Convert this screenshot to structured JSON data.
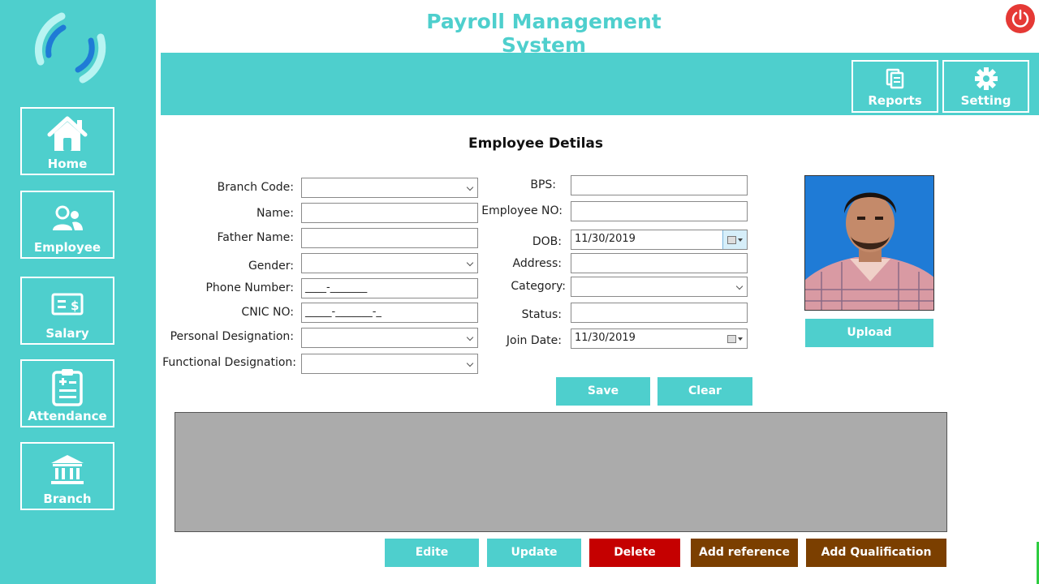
{
  "app": {
    "title": "Payroll Management System"
  },
  "sidebar": {
    "items": [
      {
        "label": "Home",
        "icon": "home-icon"
      },
      {
        "label": "Employee",
        "icon": "users-icon"
      },
      {
        "label": "Salary",
        "icon": "money-icon"
      },
      {
        "label": "Attendance",
        "icon": "clipboard-icon"
      },
      {
        "label": "Branch",
        "icon": "bank-icon"
      }
    ]
  },
  "topbar": {
    "reports_label": "Reports",
    "setting_label": "Setting"
  },
  "form": {
    "title": "Employee Detilas",
    "branch_code": {
      "label": "Branch Code:",
      "value": ""
    },
    "name": {
      "label": "Name:",
      "value": ""
    },
    "father_name": {
      "label": "Father Name:",
      "value": ""
    },
    "gender": {
      "label": "Gender:",
      "value": ""
    },
    "phone": {
      "label": "Phone Number:",
      "value": "____-_______"
    },
    "cnic": {
      "label": "CNIC NO:",
      "value": "_____-_______-_"
    },
    "personal_designation": {
      "label": "Personal Designation:",
      "value": ""
    },
    "functional_designation": {
      "label": "Functional Designation:",
      "value": ""
    },
    "bps": {
      "label": "BPS:",
      "value": ""
    },
    "employee_no": {
      "label": "Employee NO:",
      "value": ""
    },
    "dob": {
      "label": "DOB:",
      "value": "11/30/2019"
    },
    "address": {
      "label": "Address:",
      "value": ""
    },
    "category": {
      "label": "Category:",
      "value": ""
    },
    "status": {
      "label": "Status:",
      "value": ""
    },
    "join_date": {
      "label": "Join Date:",
      "value": "11/30/2019"
    }
  },
  "buttons": {
    "upload": "Upload",
    "save": "Save",
    "clear": "Clear",
    "edite": "Edite",
    "update": "Update",
    "delete": "Delete",
    "add_reference": "Add reference",
    "add_qualification": "Add Qualification"
  },
  "colors": {
    "accent": "#4ecfcd",
    "delete": "#c50000",
    "brown": "#7b3f00",
    "power": "#e53935"
  }
}
